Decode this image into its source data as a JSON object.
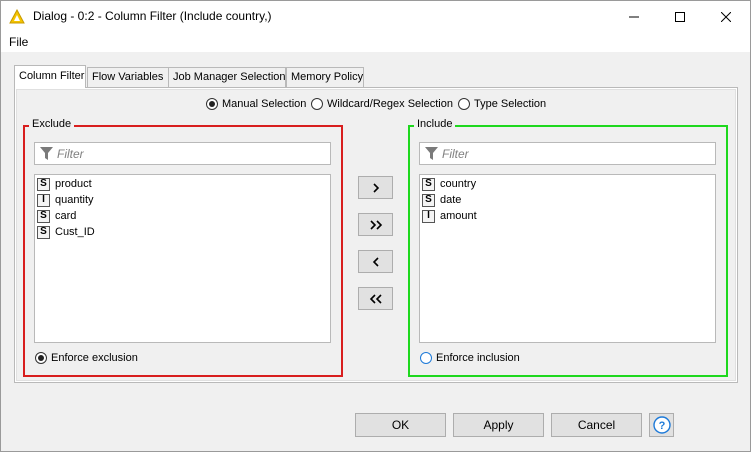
{
  "window": {
    "title": "Dialog - 0:2 - Column Filter (Include country,)",
    "controls": [
      "minimize-icon",
      "maximize-icon",
      "close-icon"
    ]
  },
  "menu": {
    "file": "File"
  },
  "tabs": [
    {
      "label": "Column Filter",
      "active": true
    },
    {
      "label": "Flow Variables",
      "active": false
    },
    {
      "label": "Job Manager Selection",
      "active": false
    },
    {
      "label": "Memory Policy",
      "active": false
    }
  ],
  "selection_modes": [
    {
      "label": "Manual Selection",
      "selected": true
    },
    {
      "label": "Wildcard/Regex Selection",
      "selected": false
    },
    {
      "label": "Type Selection",
      "selected": false
    }
  ],
  "exclude": {
    "title": "Exclude",
    "filter_placeholder": "Filter",
    "items": [
      {
        "type": "S",
        "name": "product"
      },
      {
        "type": "I",
        "name": "quantity"
      },
      {
        "type": "S",
        "name": "card"
      },
      {
        "type": "S",
        "name": "Cust_ID"
      }
    ],
    "enforce_label": "Enforce exclusion",
    "enforce_selected": true,
    "border_color": "#d81e1e"
  },
  "include": {
    "title": "Include",
    "filter_placeholder": "Filter",
    "items": [
      {
        "type": "S",
        "name": "country"
      },
      {
        "type": "S",
        "name": "date"
      },
      {
        "type": "I",
        "name": "amount"
      }
    ],
    "enforce_label": "Enforce inclusion",
    "enforce_selected": false,
    "border_color": "#1ed81e"
  },
  "move_buttons": [
    {
      "glyph": "›",
      "name": "add-selected"
    },
    {
      "glyph": "»",
      "name": "add-all"
    },
    {
      "glyph": "‹",
      "name": "remove-selected"
    },
    {
      "glyph": "«",
      "name": "remove-all"
    }
  ],
  "footer": {
    "ok": "OK",
    "apply": "Apply",
    "cancel": "Cancel",
    "help_icon": "question-icon"
  }
}
